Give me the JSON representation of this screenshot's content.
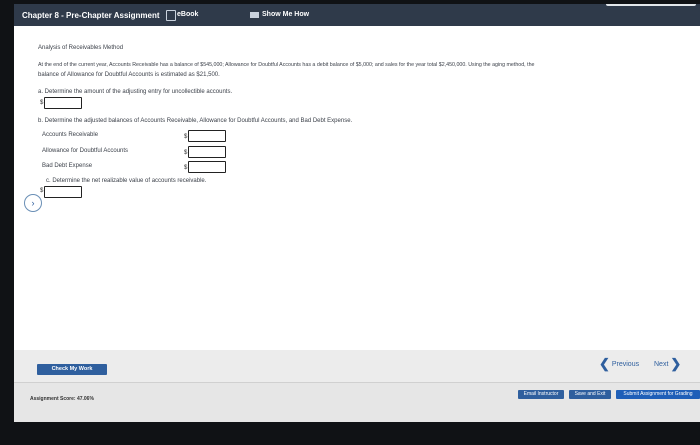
{
  "topbar": {
    "title": "Chapter 8 - Pre-Chapter Assignment",
    "ebook": "eBook",
    "show_me_how": "Show Me How"
  },
  "question": {
    "heading": "Analysis of Receivables Method",
    "intro_line1": "At the end of the current year, Accounts Receivable has a balance of $545,000; Allowance for Doubtful Accounts has a debit balance of $5,000; and sales for the year total $2,450,000. Using the aging method, the",
    "intro_line2": "balance of Allowance for Doubtful Accounts is estimated as $21,500.",
    "part_a": "a.  Determine the amount of the adjusting entry for uncollectible accounts.",
    "part_b": "b.  Determine the adjusted balances of Accounts Receivable, Allowance for Doubtful Accounts, and Bad Debt Expense.",
    "part_c": "c.  Determine the net realizable value of accounts receivable.",
    "rows": [
      {
        "label": "Accounts Receivable",
        "currency": "$"
      },
      {
        "label": "Allowance for Doubtful Accounts",
        "currency": "$"
      },
      {
        "label": "Bad Debt Expense",
        "currency": "$"
      }
    ],
    "currency": "$"
  },
  "controls": {
    "check_my_work": "Check My Work",
    "previous": "Previous",
    "next": "Next"
  },
  "status": {
    "score": "Assignment Score: 47.06%",
    "email": "Email Instructor",
    "save_exit": "Save and Exit",
    "submit": "Submit Assignment for Grading"
  }
}
